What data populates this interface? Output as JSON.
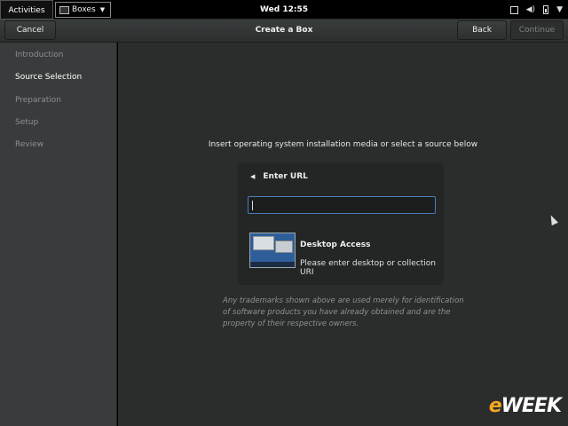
{
  "topbar": {
    "activities": "Activities",
    "app_menu": "Boxes",
    "clock": "Wed 12:55",
    "tray_icons": [
      "window-icon",
      "volume-icon",
      "battery-icon",
      "chevron-down-icon"
    ]
  },
  "header": {
    "cancel": "Cancel",
    "title": "Create a Box",
    "back": "Back",
    "continue": "Continue"
  },
  "sidebar": {
    "items": [
      {
        "label": "Introduction",
        "active": false
      },
      {
        "label": "Source Selection",
        "active": true
      },
      {
        "label": "Preparation",
        "active": false
      },
      {
        "label": "Setup",
        "active": false
      },
      {
        "label": "Review",
        "active": false
      }
    ]
  },
  "main": {
    "instruction": "Insert operating system installation media or select a source below",
    "url_label": "Enter URL",
    "url_value": "",
    "desktop_title": "Desktop Access",
    "desktop_subtitle": "Please enter desktop or collection URI",
    "disclaimer": "Any trademarks shown above are used merely for identification of software products you have already obtained and are the property of their respective owners."
  },
  "watermark": {
    "prefix": "e",
    "rest": "WEEK"
  },
  "colors": {
    "accent": "#4a7fb8",
    "sidebar_bg": "#393c3c",
    "main_bg": "#2b2c2c"
  }
}
